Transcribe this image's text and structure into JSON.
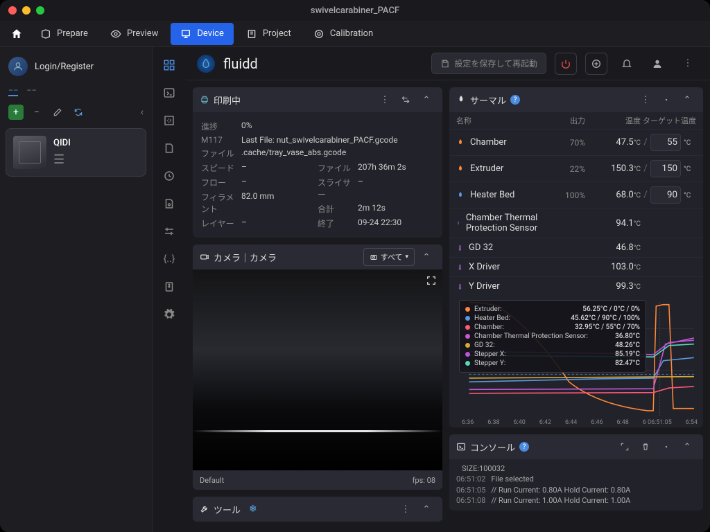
{
  "window_title": "swivelcarabiner_PACF",
  "topnav": {
    "prepare": "Prepare",
    "preview": "Preview",
    "device": "Device",
    "project": "Project",
    "calibration": "Calibration"
  },
  "sidebar": {
    "login": "Login/Register",
    "printer_name": "QIDI"
  },
  "fluidd": {
    "title": "fluidd",
    "save_btn": "設定を保存して再起動"
  },
  "print": {
    "header": "印刷中",
    "progress_k": "進捗",
    "progress_v": "0%",
    "m117_k": "M117",
    "m117_v": "Last File: nut_swivelcarabiner_PACF.gcode",
    "file_k": "ファイル",
    "file_v": ".cache/tray_vase_abs.gcode",
    "speed_k": "スピード",
    "speed_v": "–",
    "flow_k": "フロー",
    "flow_v": "–",
    "filament_k": "フィラメント",
    "filament_v": "82.0 mm",
    "layer_k": "レイヤー",
    "layer_v": "–",
    "filetime_k": "ファイル",
    "filetime_v": "207h 36m 2s",
    "slicer_k": "スライサー",
    "slicer_v": "–",
    "total_k": "合計",
    "total_v": "2m 12s",
    "end_k": "終了",
    "end_v": "09-24 22:30"
  },
  "camera": {
    "header": "カメラ｜カメラ",
    "all_btn": "すべて",
    "default_label": "Default",
    "fps": "fps: 08"
  },
  "tools": {
    "header": "ツール"
  },
  "thermal": {
    "header": "サーマル",
    "col_name": "名称",
    "col_power": "出力",
    "col_temp": "温度",
    "col_target": "ターゲット温度",
    "heaters": [
      {
        "name": "Chamber",
        "power": "70%",
        "temp": "47.5",
        "target": "55",
        "icon": "orange"
      },
      {
        "name": "Extruder",
        "power": "22%",
        "temp": "150.3",
        "target": "150",
        "icon": "orange"
      },
      {
        "name": "Heater Bed",
        "power": "100%",
        "temp": "68.0",
        "target": "90",
        "icon": "blue"
      }
    ],
    "sensors": [
      {
        "name": "Chamber Thermal Protection Sensor",
        "temp": "94.1"
      },
      {
        "name": "GD 32",
        "temp": "46.8"
      },
      {
        "name": "X Driver",
        "temp": "103.0"
      },
      {
        "name": "Y Driver",
        "temp": "99.3"
      }
    ]
  },
  "chart_data": {
    "type": "line",
    "xlabel": "time",
    "ylim": [
      0,
      150
    ],
    "yticks": [
      50,
      100
    ],
    "x_ticks": [
      "6:36",
      "6:38",
      "6:40",
      "6:42",
      "6:44",
      "6:46",
      "6:48",
      "6 06:51:05",
      "6:54"
    ],
    "tooltip_time": "06:51:05",
    "series": [
      {
        "name": "Extruder:",
        "color": "#ff8838",
        "val": "56.25°C / 0°C / 0%"
      },
      {
        "name": "Heater Bed:",
        "color": "#5a9ae0",
        "val": "45.62°C / 90°C / 100%"
      },
      {
        "name": "Chamber:",
        "color": "#ff5a7a",
        "val": "32.95°C / 55°C / 70%"
      },
      {
        "name": "Chamber Thermal Protection Sensor:",
        "color": "#c858d8",
        "val": "36.80°C"
      },
      {
        "name": "GD 32:",
        "color": "#d8a838",
        "val": "48.26°C"
      },
      {
        "name": "Stepper X:",
        "color": "#b858d8",
        "val": "85.19°C"
      },
      {
        "name": "Stepper Y:",
        "color": "#58d8b8",
        "val": "82.47°C"
      }
    ]
  },
  "console": {
    "header": "コンソール",
    "lines": [
      {
        "ts": "",
        "msg": "SIZE:100032"
      },
      {
        "ts": "06:51:02",
        "msg": "File selected"
      },
      {
        "ts": "06:51:05",
        "msg": "// Run Current: 0.80A Hold Current: 0.80A"
      },
      {
        "ts": "06:51:08",
        "msg": "// Run Current: 1.00A Hold Current: 1.00A"
      }
    ]
  }
}
